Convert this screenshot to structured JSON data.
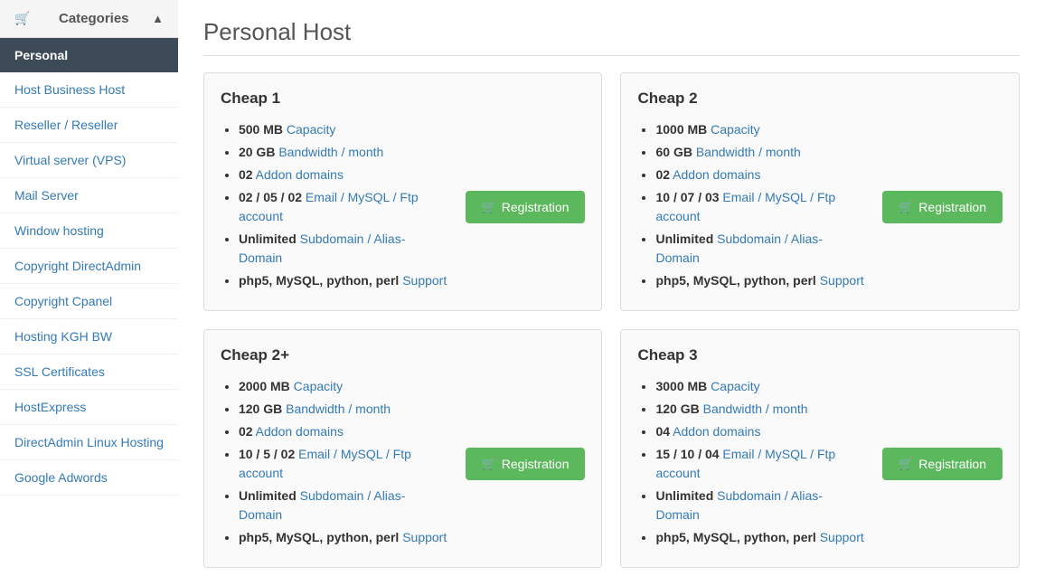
{
  "sidebar": {
    "header": {
      "title": "Categories",
      "icon": "▲"
    },
    "active_item": "Personal",
    "items": [
      {
        "label": "Personal",
        "active": true
      },
      {
        "label": "Host Business Host"
      },
      {
        "label": "Reseller / Reseller"
      },
      {
        "label": "Virtual server (VPS)"
      },
      {
        "label": "Mail Server"
      },
      {
        "label": "Window hosting"
      },
      {
        "label": "Copyright DirectAdmin"
      },
      {
        "label": "Copyright Cpanel"
      },
      {
        "label": "Hosting KGH BW"
      },
      {
        "label": "SSL Certificates"
      },
      {
        "label": "HostExpress"
      },
      {
        "label": "DirectAdmin Linux Hosting"
      },
      {
        "label": "Google Adwords"
      }
    ]
  },
  "page": {
    "title": "Personal Host"
  },
  "cards": [
    {
      "id": "cheap1",
      "title": "Cheap 1",
      "features": [
        {
          "bold": "500 MB",
          "normal": " Capacity"
        },
        {
          "bold": "20 GB",
          "normal": " Bandwidth / month"
        },
        {
          "bold": "02",
          "normal": " Addon domains"
        },
        {
          "bold": "02 / 05 / 02",
          "normal": " Email / MySQL / Ftp account"
        },
        {
          "bold": "Unlimited",
          "normal": " Subdomain / Alias-Domain"
        },
        {
          "bold": "php5, MySQL, python, perl",
          "normal": " Support"
        }
      ],
      "button": "Registration"
    },
    {
      "id": "cheap2",
      "title": "Cheap 2",
      "features": [
        {
          "bold": "1000 MB",
          "normal": " Capacity"
        },
        {
          "bold": "60 GB",
          "normal": " Bandwidth / month"
        },
        {
          "bold": "02",
          "normal": " Addon domains"
        },
        {
          "bold": "10 / 07 / 03",
          "normal": " Email / MySQL / Ftp account"
        },
        {
          "bold": "Unlimited",
          "normal": " Subdomain / Alias-Domain"
        },
        {
          "bold": "php5, MySQL, python, perl",
          "normal": " Support"
        }
      ],
      "button": "Registration"
    },
    {
      "id": "cheap2plus",
      "title": "Cheap 2+",
      "features": [
        {
          "bold": "2000 MB",
          "normal": " Capacity"
        },
        {
          "bold": "120 GB",
          "normal": " Bandwidth / month"
        },
        {
          "bold": "02",
          "normal": " Addon domains"
        },
        {
          "bold": "10 / 5 / 02",
          "normal": " Email / MySQL / Ftp account"
        },
        {
          "bold": "Unlimited",
          "normal": " Subdomain / Alias-Domain"
        },
        {
          "bold": "php5, MySQL, python, perl",
          "normal": " Support"
        }
      ],
      "button": "Registration"
    },
    {
      "id": "cheap3",
      "title": "Cheap 3",
      "features": [
        {
          "bold": "3000 MB",
          "normal": " Capacity"
        },
        {
          "bold": "120 GB",
          "normal": " Bandwidth / month"
        },
        {
          "bold": "04",
          "normal": " Addon domains"
        },
        {
          "bold": "15 / 10 / 04",
          "normal": " Email / MySQL / Ftp account"
        },
        {
          "bold": "Unlimited",
          "normal": " Subdomain / Alias-Domain"
        },
        {
          "bold": "php5, MySQL, python, perl",
          "normal": " Support"
        }
      ],
      "button": "Registration"
    }
  ],
  "icons": {
    "cart": "🛒"
  }
}
